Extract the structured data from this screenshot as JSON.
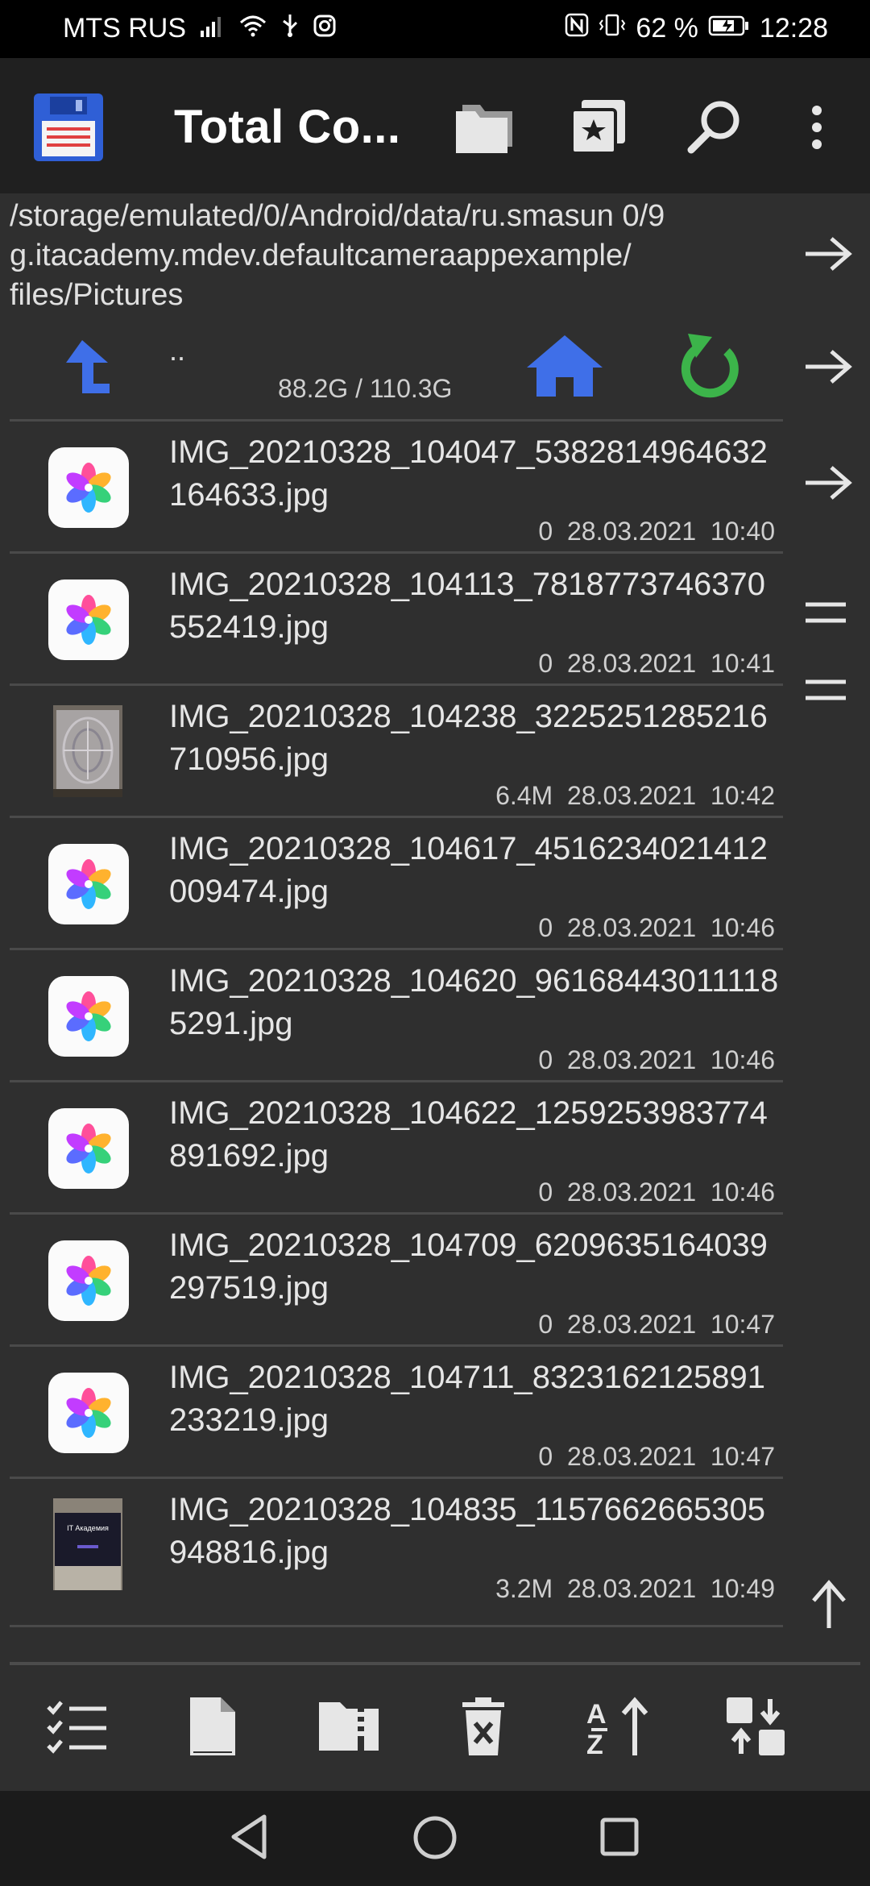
{
  "status_bar": {
    "carrier": "MTS RUS",
    "battery_percent": "62 %",
    "time": "12:28",
    "icons": [
      "signal-icon",
      "wifi-icon",
      "usb-icon",
      "instagram-icon",
      "nfc-icon",
      "vibrate-icon",
      "battery-icon"
    ]
  },
  "app_bar": {
    "title": "Total Co...",
    "icons": [
      "floppy-disk-icon",
      "folders-icon",
      "bookmarks-icon",
      "search-icon",
      "more-vert-icon"
    ]
  },
  "path": {
    "text": "/storage/emulated/0/Android/data/ru.smasun 0/9g.itacademy.mdev.defaultcameraappexample/files/Pictures",
    "line1": "/storage/emulated/0/Android/data/ru.smasun 0/9",
    "line2": "g.itacademy.mdev.defaultcameraappexample/",
    "line3": "files/Pictures"
  },
  "up_dir": {
    "label": "..",
    "space": "88.2G / 110.3G"
  },
  "files": [
    {
      "name": "IMG_20210328_104047_5382814964632164633.jpg",
      "size": "0",
      "date": "28.03.2021",
      "time": "10:40",
      "thumb": "gallery"
    },
    {
      "name": "IMG_20210328_104113_7818773746370552419.jpg",
      "size": "0",
      "date": "28.03.2021",
      "time": "10:41",
      "thumb": "gallery"
    },
    {
      "name": "IMG_20210328_104238_3225251285216710956.jpg",
      "size": "6.4M",
      "date": "28.03.2021",
      "time": "10:42",
      "thumb": "photo-pattern"
    },
    {
      "name": "IMG_20210328_104617_4516234021412009474.jpg",
      "size": "0",
      "date": "28.03.2021",
      "time": "10:46",
      "thumb": "gallery"
    },
    {
      "name": "IMG_20210328_104620_961684430111185291.jpg",
      "size": "0",
      "date": "28.03.2021",
      "time": "10:46",
      "thumb": "gallery"
    },
    {
      "name": "IMG_20210328_104622_1259253983774891692.jpg",
      "size": "0",
      "date": "28.03.2021",
      "time": "10:46",
      "thumb": "gallery"
    },
    {
      "name": "IMG_20210328_104709_6209635164039297519.jpg",
      "size": "0",
      "date": "28.03.2021",
      "time": "10:47",
      "thumb": "gallery"
    },
    {
      "name": "IMG_20210328_104711_8323162125891233219.jpg",
      "size": "0",
      "date": "28.03.2021",
      "time": "10:47",
      "thumb": "gallery"
    },
    {
      "name": "IMG_20210328_104835_1157662665305948816.jpg",
      "size": "3.2M",
      "date": "28.03.2021",
      "time": "10:49",
      "thumb": "photo-screen"
    }
  ],
  "photo_screen_caption": "IT Академия",
  "side_panel_icons": [
    "arrow-right-icon",
    "arrow-right-icon",
    "arrow-right-icon",
    "menu-lines-icon",
    "menu-lines-icon",
    "arrow-up-icon"
  ],
  "bottom_toolbar": [
    "select-list-icon",
    "new-file-icon",
    "zip-folder-icon",
    "delete-icon",
    "sort-az-icon",
    "swap-panels-icon"
  ],
  "nav_bar": [
    "back-icon",
    "home-icon",
    "recents-icon"
  ],
  "colors": {
    "background": "#2f2f2f",
    "app_bar": "#202020",
    "accent_blue": "#3f6fe8",
    "accent_green": "#3cb44a",
    "text": "#e6e6e6"
  }
}
